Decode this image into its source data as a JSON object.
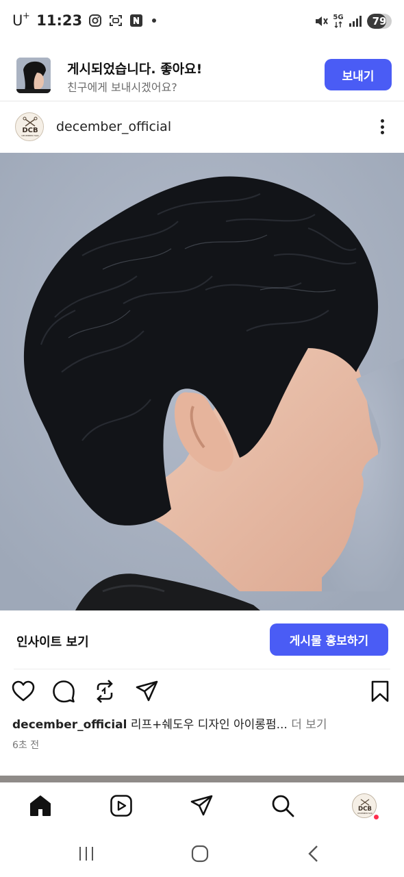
{
  "status_bar": {
    "carrier": "U",
    "carrier_sup": "+",
    "time": "11:23",
    "left_icons": [
      "instagram-icon",
      "camera-scan-icon",
      "naver-icon"
    ],
    "right_icons": [
      "mute-icon",
      "5g-signal-icon",
      "signal-bars-icon"
    ],
    "network": "5G",
    "battery_level": 79,
    "battery_text": "79"
  },
  "banner": {
    "title": "게시되었습니다. 좋아요!",
    "subtitle": "친구에게 보내시겠어요?",
    "send_label": "보내기"
  },
  "post": {
    "username": "december_official",
    "avatar_text": "DCB",
    "avatar_subtext": "DECEMBER HAIR",
    "insights_label": "인사이트 보기",
    "promote_label": "게시물 홍보하기",
    "caption_user": "december_official",
    "caption_text": "리프+쉐도우 디자인 아이롱펌...",
    "caption_more": "더 보기",
    "time_ago": "6초 전"
  },
  "actions": [
    "heart-icon",
    "comment-icon",
    "repost-icon",
    "send-icon",
    "bookmark-icon"
  ],
  "bottom_nav": [
    "home-icon",
    "reels-icon",
    "direct-icon",
    "search-icon",
    "profile-avatar"
  ],
  "system_nav": [
    "recents-icon",
    "home-circle-icon",
    "back-icon"
  ],
  "colors": {
    "accent": "#4a5cf5",
    "background": "#ffffff",
    "photo_background": "#aab3c2",
    "notification_dot": "#ff2e4d"
  }
}
